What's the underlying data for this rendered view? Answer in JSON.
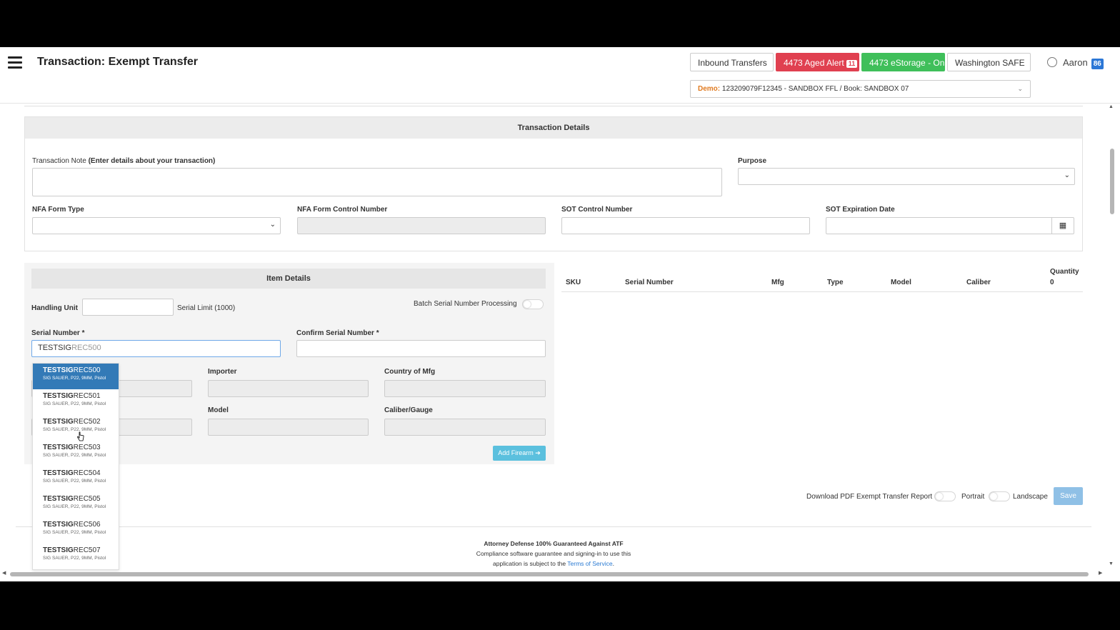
{
  "header": {
    "title": "Transaction: Exempt Transfer",
    "buttons": {
      "inbound": "Inbound Transfers",
      "aged": "4473 Aged Alert",
      "aged_count": "11",
      "estorage": "4473 eStorage - On",
      "safe": "Washington SAFE"
    },
    "user": {
      "name": "Aaron",
      "badge": "86"
    },
    "book": {
      "prefix": "Demo:",
      "value": "123209079F12345 - SANDBOX FFL / Book: SANDBOX 07"
    }
  },
  "transaction": {
    "heading": "Transaction Details",
    "note_label": "Transaction Note",
    "note_hint": "(Enter details about your transaction)",
    "purpose_label": "Purpose",
    "nfa_type_label": "NFA Form Type",
    "nfa_control_label": "NFA Form Control Number",
    "sot_control_label": "SOT Control Number",
    "sot_exp_label": "SOT Expiration Date"
  },
  "items": {
    "heading": "Item Details",
    "handling_unit_label": "Handling Unit",
    "serial_limit": "Serial Limit (1000)",
    "batch_label": "Batch Serial Number Processing",
    "serial_label": "Serial Number *",
    "confirm_label": "Confirm Serial Number *",
    "serial_typed": "TESTSIG",
    "serial_suggest": "REC500",
    "importer_label": "Importer",
    "country_label": "Country of Mfg",
    "model_label": "Model",
    "caliber_label": "Caliber/Gauge",
    "add_button": "Add Firearm ➔"
  },
  "suggestions": [
    {
      "prefix": "TESTSIG",
      "rest": "REC500",
      "desc": "SIG SAUER, P22, 9MM, Pistol"
    },
    {
      "prefix": "TESTSIG",
      "rest": "REC501",
      "desc": "SIG SAUER, P22, 9MM, Pistol"
    },
    {
      "prefix": "TESTSIG",
      "rest": "REC502",
      "desc": "SIG SAUER, P22, 9MM, Pistol"
    },
    {
      "prefix": "TESTSIG",
      "rest": "REC503",
      "desc": "SIG SAUER, P22, 9MM, Pistol"
    },
    {
      "prefix": "TESTSIG",
      "rest": "REC504",
      "desc": "SIG SAUER, P22, 9MM, Pistol"
    },
    {
      "prefix": "TESTSIG",
      "rest": "REC505",
      "desc": "SIG SAUER, P22, 9MM, Pistol"
    },
    {
      "prefix": "TESTSIG",
      "rest": "REC506",
      "desc": "SIG SAUER, P22, 9MM, Pistol"
    },
    {
      "prefix": "TESTSIG",
      "rest": "REC507",
      "desc": "SIG SAUER, P22, 9MM, Pistol"
    }
  ],
  "table": {
    "columns": [
      "SKU",
      "Serial Number",
      "Mfg",
      "Type",
      "Model",
      "Caliber"
    ],
    "quantity_label": "Quantity",
    "quantity_value": "0"
  },
  "report": {
    "download_label": "Download PDF Exempt Transfer Report",
    "portrait": "Portrait",
    "landscape": "Landscape",
    "save": "Save"
  },
  "footer": {
    "title": "Attorney Defense 100% Guaranteed Against ATF",
    "line1": "Compliance software guarantee and signing-in to use this",
    "line2": "application is subject to the",
    "link": "Terms of Service",
    "end": "."
  },
  "icons": {
    "menu": "hamburger-icon",
    "user": "user-circle-icon",
    "calendar": "calendar-icon",
    "chevron": "chevron-down-icon"
  },
  "colors": {
    "aged_alert": "#e04050",
    "estorage": "#3fbf5a",
    "user_badge": "#2c77d6",
    "demo_text": "#e07a20",
    "dropdown_active": "#337ab7",
    "add_button": "#5bc0de",
    "save_button": "#8fc0e6",
    "link": "#2a7ad2"
  }
}
